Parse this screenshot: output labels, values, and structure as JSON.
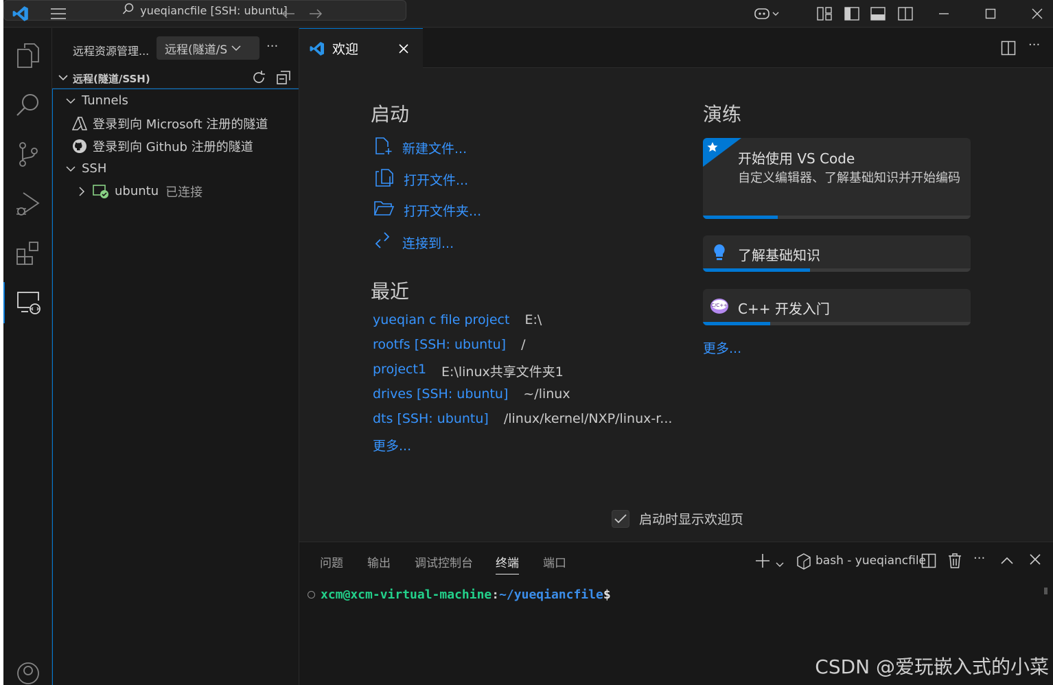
{
  "titlebar": {
    "search_text": "yueqiancfile [SSH: ubuntu]"
  },
  "sidebar": {
    "title": "远程资源管理...",
    "select_value": "远程(隧道/S",
    "more": "···",
    "section_title": "远程(隧道/SSH)",
    "tree": [
      {
        "label": "Tunnels",
        "kind": "group"
      },
      {
        "label": "登录到向 Microsoft 注册的隧道",
        "kind": "item",
        "icon": "azure-icon"
      },
      {
        "label": "登录到向 Github 注册的隧道",
        "kind": "item",
        "icon": "github-icon"
      },
      {
        "label": "SSH",
        "kind": "group"
      },
      {
        "label": "ubuntu",
        "status": "已连接",
        "kind": "host",
        "icon": "remote-connected-icon"
      }
    ]
  },
  "editor": {
    "tab_label": "欢迎",
    "start": {
      "heading": "启动",
      "items": [
        {
          "label": "新建文件...",
          "icon": "new-file-icon"
        },
        {
          "label": "打开文件...",
          "icon": "open-file-icon"
        },
        {
          "label": "打开文件夹...",
          "icon": "open-folder-icon"
        },
        {
          "label": "连接到...",
          "icon": "remote-connect-icon"
        }
      ]
    },
    "recent": {
      "heading": "最近",
      "items": [
        {
          "name": "yueqian c file project",
          "path": "E:\\"
        },
        {
          "name": "rootfs [SSH: ubuntu]",
          "path": "/"
        },
        {
          "name": "project1",
          "path": "E:\\linux共享文件夹1"
        },
        {
          "name": "drives [SSH: ubuntu]",
          "path": "~/linux"
        },
        {
          "name": "dts [SSH: ubuntu]",
          "path": "/linux/kernel/NXP/linux-r..."
        }
      ],
      "more": "更多..."
    },
    "walkthroughs": {
      "heading": "演练",
      "cards": [
        {
          "title": "开始使用 VS Code",
          "desc": "自定义编辑器、了解基础知识并开始编码",
          "progress": 0.28
        },
        {
          "title": "了解基础知识",
          "progress": 0.4
        },
        {
          "title": "C++ 开发入门",
          "progress": 0.25
        }
      ],
      "more": "更多..."
    },
    "show_on_startup": {
      "label": "启动时显示欢迎页",
      "checked": true
    }
  },
  "panel": {
    "tabs": [
      "问题",
      "输出",
      "调试控制台",
      "终端",
      "端口"
    ],
    "active_tab": "终端",
    "terminal_name": "bash - yueqiancfile",
    "prompt": {
      "user_host": "xcm@xcm-virtual-machine",
      "sep": ":",
      "path": "~/yueqiancfile",
      "symbol": "$"
    }
  },
  "colors": {
    "accent": "#0078d4",
    "link": "#3794ff",
    "prompt_green": "#23d18b",
    "prompt_blue": "#3b8eea"
  },
  "watermark": "CSDN @爱玩嵌入式的小菜"
}
